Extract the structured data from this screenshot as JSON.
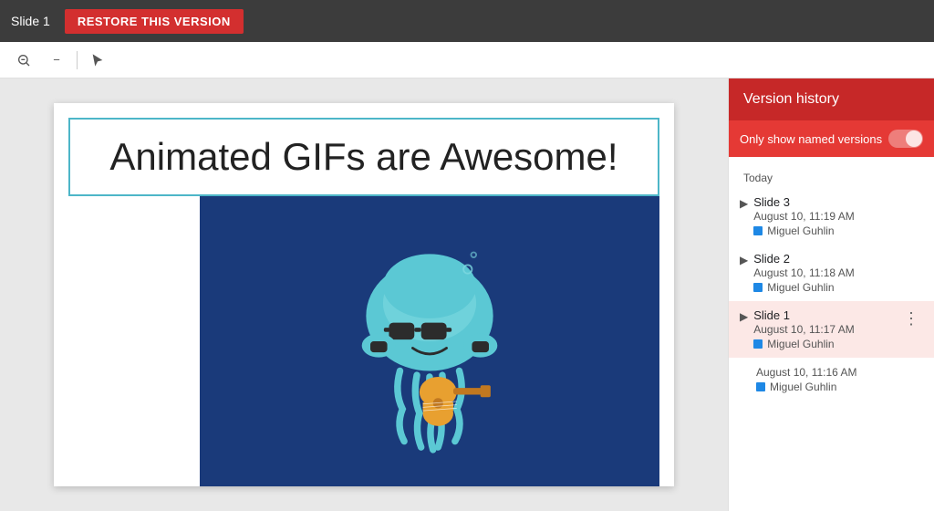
{
  "toolbar": {
    "slide_label": "Slide 1",
    "restore_btn": "RESTORE THIS VERSION"
  },
  "canvas": {
    "slide_title": "Animated GIFs are Awesome!"
  },
  "version_panel": {
    "header": "Version history",
    "toggle_label": "Only show named versions",
    "section_today": "Today",
    "versions": [
      {
        "name": "Slide 3",
        "time": "August 10, 11:19 AM",
        "user": "Miguel Guhlin",
        "has_name": true,
        "active": false
      },
      {
        "name": "Slide 2",
        "time": "August 10, 11:18 AM",
        "user": "Miguel Guhlin",
        "has_name": true,
        "active": false
      },
      {
        "name": "Slide 1",
        "time": "August 10, 11:17 AM",
        "user": "Miguel Guhlin",
        "has_name": true,
        "active": true
      },
      {
        "name": "",
        "time": "August 10, 11:16 AM",
        "user": "Miguel Guhlin",
        "has_name": false,
        "active": false
      }
    ]
  }
}
